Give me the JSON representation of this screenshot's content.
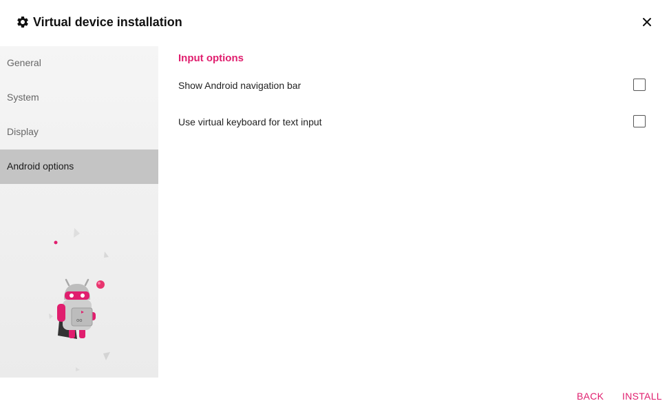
{
  "window": {
    "title": "Virtual device installation",
    "title_icon": "gear-icon",
    "close_icon": "close-icon"
  },
  "sidebar": {
    "items": [
      {
        "label": "General",
        "active": false
      },
      {
        "label": "System",
        "active": false
      },
      {
        "label": "Display",
        "active": false
      },
      {
        "label": "Android options",
        "active": true
      }
    ]
  },
  "main": {
    "section_title": "Input options",
    "options": [
      {
        "label": "Show Android navigation bar",
        "checked": false
      },
      {
        "label": "Use virtual keyboard for text input",
        "checked": false
      }
    ]
  },
  "footer": {
    "back_label": "BACK",
    "install_label": "INSTALL"
  },
  "colors": {
    "accent": "#e01e6e",
    "sidebar_active": "#c4c4c4",
    "sidebar_bg": "#f2f2f2"
  }
}
